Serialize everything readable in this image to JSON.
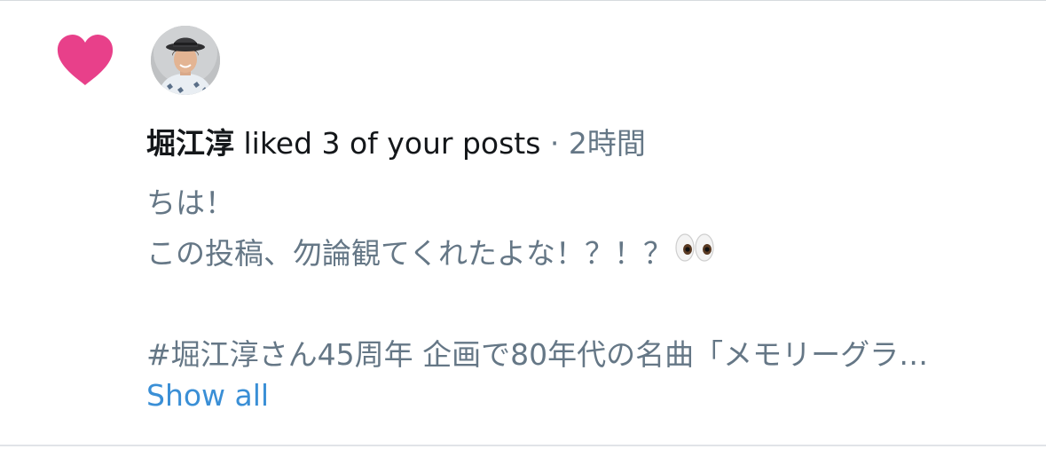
{
  "notification": {
    "user_name": "堀江淳",
    "action_text": " liked 3 of your posts",
    "separator": " · ",
    "timestamp": "2時間",
    "post_lines": [
      "ちは！",
      "この投稿、勿論観てくれたよな！？！？",
      "",
      "#堀江淳さん45周年 企画で80年代の名曲「メモリーグラ…"
    ],
    "show_all_label": "Show all"
  },
  "icons": {
    "like": "heart-icon",
    "avatar": "avatar",
    "emoji": "eyes-emoji"
  },
  "colors": {
    "heart": "#e8408a",
    "primary_text": "#14171a",
    "secondary_text": "#657786",
    "link": "#3a8fd6",
    "divider": "#e1e4e8"
  }
}
